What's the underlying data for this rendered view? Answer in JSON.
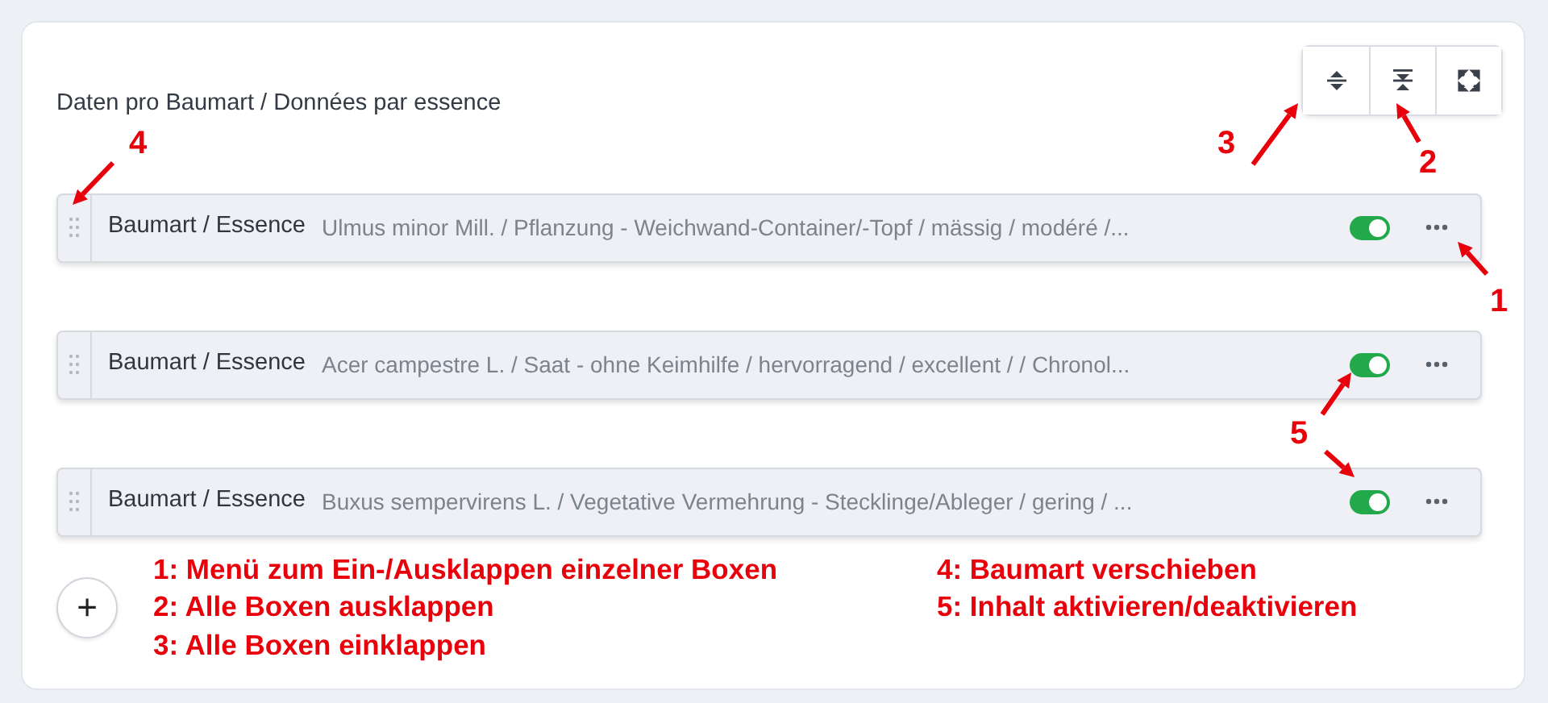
{
  "section": {
    "title": "Daten pro Baumart / Données par essence"
  },
  "toolbar": [
    {
      "kind": "collapse-all"
    },
    {
      "kind": "expand-all"
    },
    {
      "kind": "fullscreen"
    }
  ],
  "rows": [
    {
      "label": "Baumart / Essence",
      "summary": "Ulmus minor Mill. / Pflanzung - Weichwand-Container/-Topf / mässig / modéré /...",
      "enabled": true
    },
    {
      "label": "Baumart / Essence",
      "summary": "Acer campestre L. / Saat - ohne Keimhilfe / hervorragend / excellent / / Chronol...",
      "enabled": true
    },
    {
      "label": "Baumart / Essence",
      "summary": "Buxus sempervirens L. / Vegetative Vermehrung - Stecklinge/Ableger / gering / ...",
      "enabled": true
    }
  ],
  "add_button": {
    "label": "+"
  },
  "legend": [
    [
      "1: Menü zum Ein-/Ausklappen einzelner Boxen",
      "2: Alle Boxen ausklappen",
      "3: Alle Boxen einklappen"
    ],
    [
      "4: Baumart verschieben",
      "5: Inhalt aktivieren/deaktivieren"
    ]
  ],
  "annotations": [
    {
      "number": "4"
    },
    {
      "number": "3"
    },
    {
      "number": "2"
    },
    {
      "number": "1"
    },
    {
      "number": "5"
    }
  ]
}
